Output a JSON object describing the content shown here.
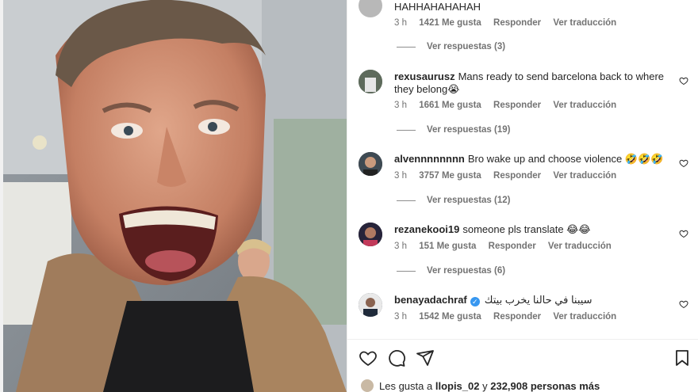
{
  "post": {
    "liked_by_prefix": "Les gusta a",
    "liked_by_user": "llopis_02",
    "liked_by_conj": "y",
    "liked_by_others": "232,908 personas más"
  },
  "labels": {
    "reply": "Responder",
    "translate": "Ver traducción"
  },
  "top_comment": {
    "text": "HAHHAHAHAHAH",
    "time": "3 h",
    "likes": "1421 Me gusta",
    "replies": "Ver respuestas (3)"
  },
  "comments": [
    {
      "username": "rexusaurusz",
      "text": "Mans ready to send barcelona back to where they belong😭",
      "time": "3 h",
      "likes": "1661 Me gusta",
      "replies": "Ver respuestas (19)"
    },
    {
      "username": "alvennnnnnnn",
      "text": "Bro wake up and choose violence 🤣🤣🤣",
      "time": "3 h",
      "likes": "3757 Me gusta",
      "replies": "Ver respuestas (12)"
    },
    {
      "username": "rezanekooi19",
      "text": "someone pls translate 😂😂",
      "time": "3 h",
      "likes": "151 Me gusta",
      "replies": "Ver respuestas (6)"
    },
    {
      "username": "benayadachraf",
      "verified": true,
      "text": "سيبنا في حالنا يخرب بيتك",
      "time": "3 h",
      "likes": "1542 Me gusta"
    }
  ],
  "icons": [
    "heart-icon",
    "comment-icon",
    "share-icon",
    "bookmark-icon",
    "verified-badge-icon"
  ],
  "colors": {
    "meta_gray": "#737373",
    "verified_blue": "#3797f0",
    "text": "#262626"
  }
}
